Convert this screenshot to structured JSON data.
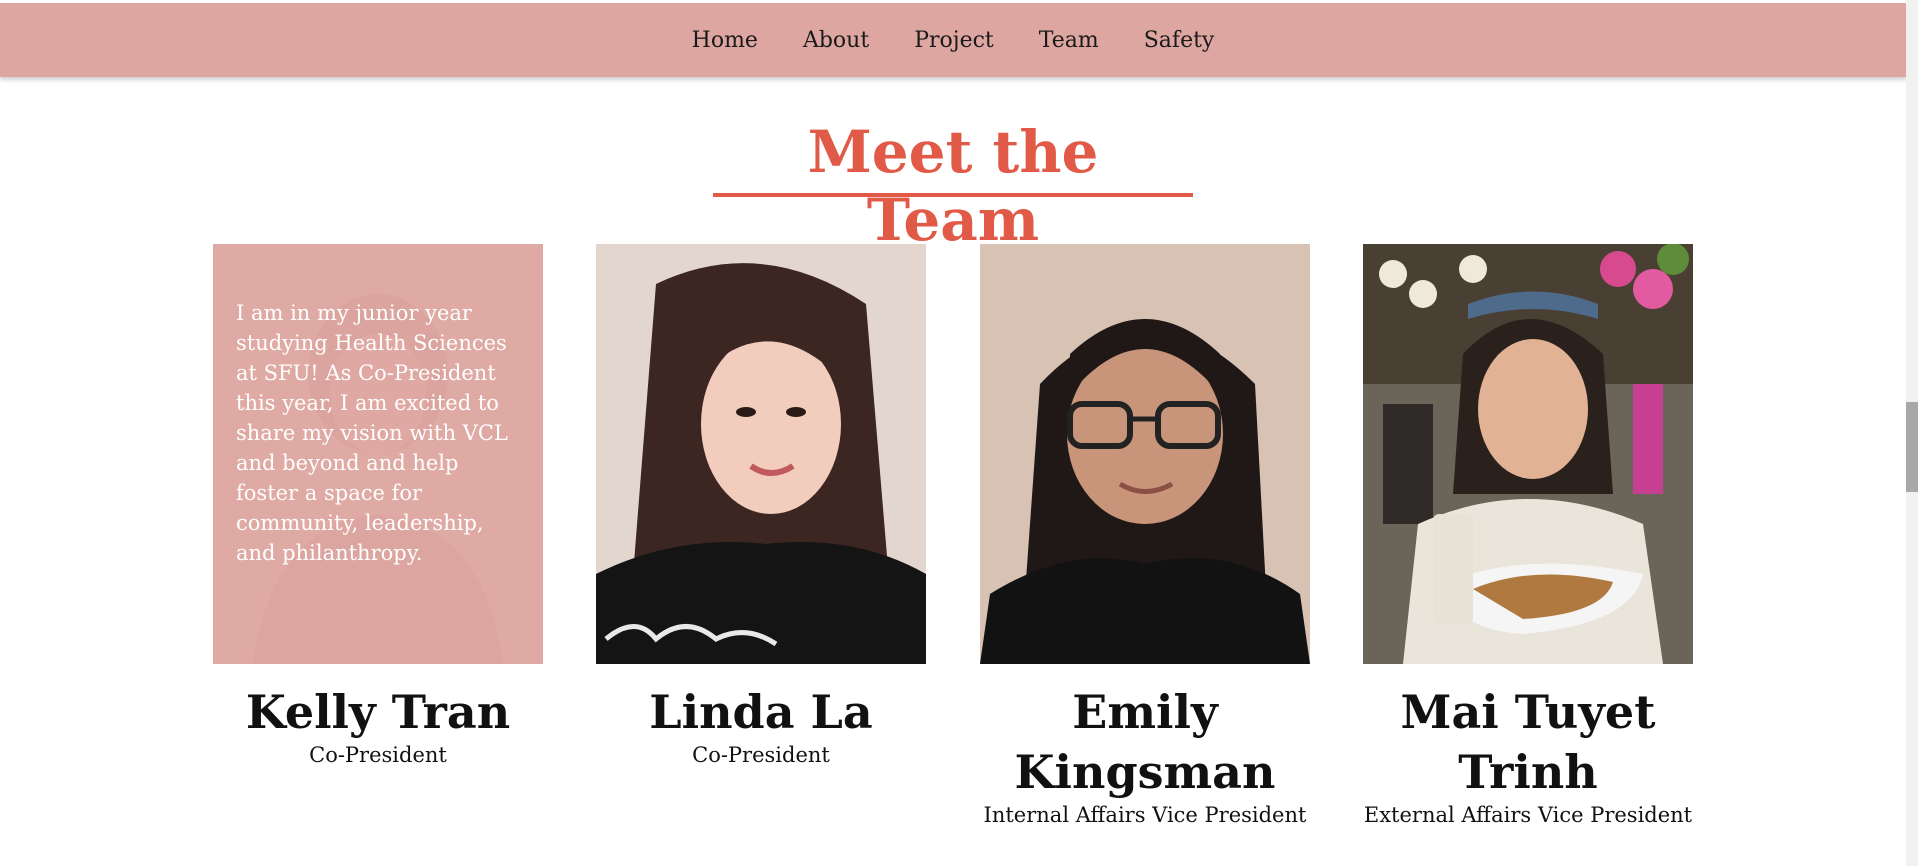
{
  "colors": {
    "nav_bg": "#dea6a1",
    "accent": "#e05a47",
    "bio_overlay": "#dea6a1",
    "text_dark": "#111111",
    "bio_text": "#ffffff"
  },
  "nav": {
    "items": [
      {
        "label": "Home"
      },
      {
        "label": "About"
      },
      {
        "label": "Project"
      },
      {
        "label": "Team"
      },
      {
        "label": "Safety"
      }
    ]
  },
  "team": {
    "title": "Meet the Team",
    "members": [
      {
        "name": "Kelly Tran",
        "role": "Co-President",
        "bio": "I am in my junior year studying Health Sciences at SFU! As Co-President this year, I am excited to share my vision with VCL and beyond and help foster a space for community, leadership, and philanthropy."
      },
      {
        "name": "Linda La",
        "role": "Co-President"
      },
      {
        "name": "Emily Kingsman",
        "role": "Internal Affairs Vice President"
      },
      {
        "name": "Mai Tuyet Trinh",
        "role": "External Affairs Vice President"
      }
    ]
  }
}
